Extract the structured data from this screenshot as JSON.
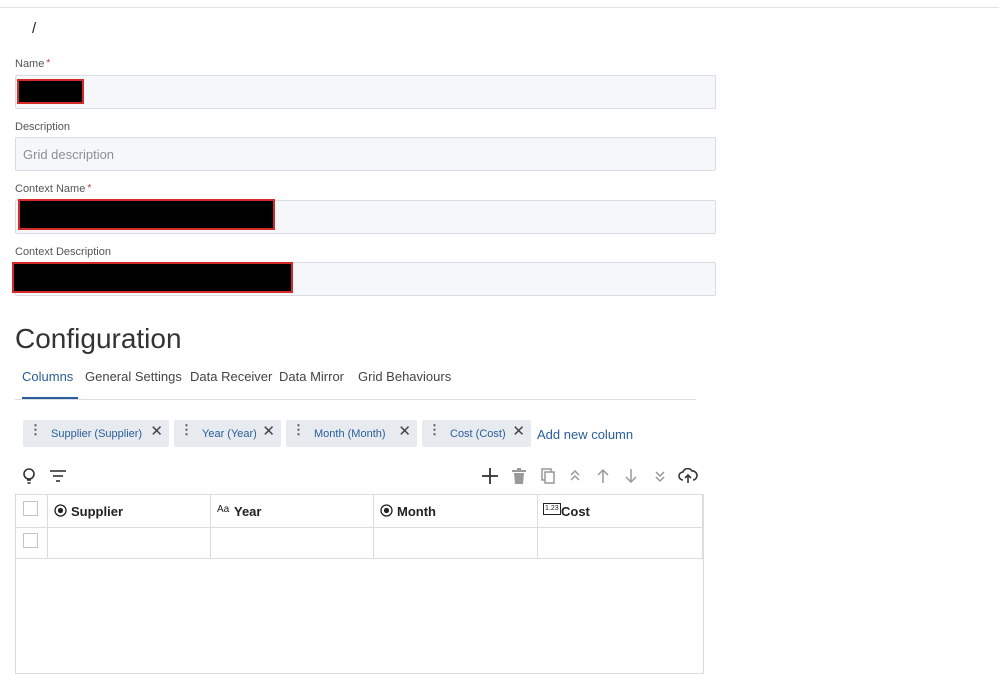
{
  "breadcrumb": "/",
  "form": {
    "name_label": "Name",
    "required_mark": "*",
    "name_value": "",
    "description_label": "Description",
    "description_placeholder": "Grid description",
    "context_name_label": "Context Name",
    "context_name_value": "",
    "context_description_label": "Context Description",
    "context_description_value": ""
  },
  "configuration": {
    "title": "Configuration",
    "tabs": [
      {
        "label": "Columns",
        "active": true
      },
      {
        "label": "General Settings",
        "active": false
      },
      {
        "label": "Data Receiver",
        "active": false
      },
      {
        "label": "Data Mirror",
        "active": false
      },
      {
        "label": "Grid Behaviours",
        "active": false
      }
    ],
    "chips": [
      {
        "label": "Supplier (Supplier)"
      },
      {
        "label": "Year (Year)"
      },
      {
        "label": "Month (Month)"
      },
      {
        "label": "Cost (Cost)"
      }
    ],
    "add_column_label": "Add new column",
    "grid": {
      "columns": [
        {
          "label": "Supplier",
          "icon": "radio-icon"
        },
        {
          "label": "Year",
          "icon": "text-type-icon"
        },
        {
          "label": "Month",
          "icon": "radio-icon"
        },
        {
          "label": "Cost",
          "icon": "number-type-icon"
        }
      ],
      "rows": [
        [
          "",
          "",
          "",
          ""
        ]
      ]
    }
  },
  "icons": {
    "chip_drag": "⋮",
    "chip_close": "✕",
    "text_type_glyph": "Aa",
    "number_type_glyph": "1.23"
  },
  "colors": {
    "accent": "#2a5e9a",
    "redact_border": "#d42a2a",
    "required": "#d32f2f"
  }
}
